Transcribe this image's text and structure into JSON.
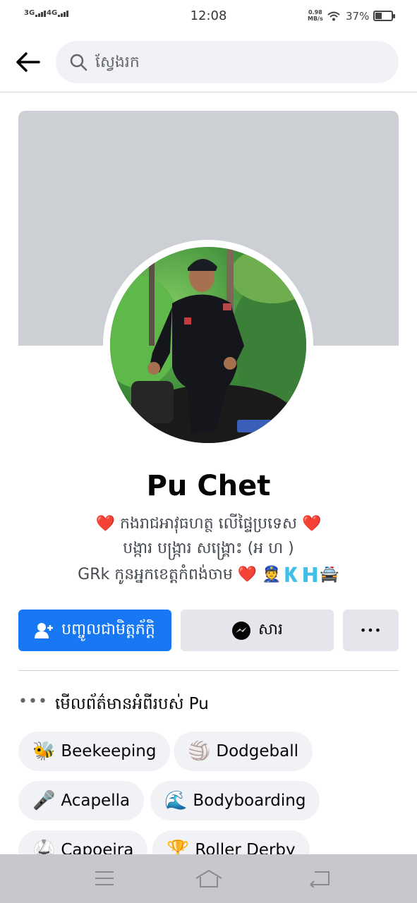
{
  "status_bar": {
    "net1": "3G",
    "net2": "4G",
    "time": "12:08",
    "speed_value": "0.98",
    "speed_unit": "MB/s",
    "battery": "37%",
    "battery_level": 0.37
  },
  "search": {
    "placeholder": "ស្វែងរក"
  },
  "profile": {
    "name": "Pu Chet",
    "bio_line1": "កងរាជអាវុធហត្ថ លើផ្ទៃប្រទេស",
    "bio_line2": "បង្ការ បង្ក្រារ សង្គ្រោះ (អ ហ )",
    "bio_line3": "GRk កូនអ្នកខេត្តកំពង់ចាម",
    "bio_line3_emojis": "👮🇰🇭🚔"
  },
  "actions": {
    "add_friend": "បញ្ចូលជាមិត្តភ័ក្ដិ",
    "message": "សារ",
    "more": "•••"
  },
  "about": {
    "dots": "•••",
    "label": "មើលព័ត៌មានអំពីរបស់ Pu"
  },
  "hobbies": [
    {
      "emoji": "🐝",
      "label": "Beekeeping"
    },
    {
      "emoji": "🏐",
      "label": "Dodgeball"
    },
    {
      "emoji": "🎤",
      "label": "Acapella"
    },
    {
      "emoji": "🌊",
      "label": "Bodyboarding"
    },
    {
      "emoji": "🥋",
      "label": "Capoeira"
    },
    {
      "emoji": "🏆",
      "label": "Roller Derby"
    }
  ],
  "colors": {
    "primary": "#1877f2",
    "heart": "#e41e3f",
    "chip_bg": "#f0f2f5",
    "cover_bg": "#ccd0d5"
  }
}
